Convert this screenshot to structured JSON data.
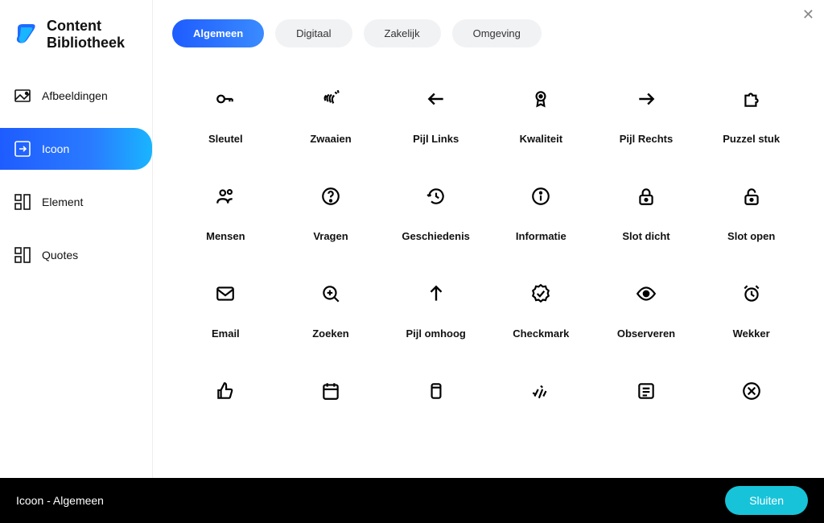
{
  "brand": {
    "title": "Content\nBibliotheek"
  },
  "sidebar": {
    "items": [
      {
        "label": "Afbeeldingen",
        "active": false
      },
      {
        "label": "Icoon",
        "active": true
      },
      {
        "label": "Element",
        "active": false
      },
      {
        "label": "Quotes",
        "active": false
      }
    ]
  },
  "tabs": [
    {
      "label": "Algemeen",
      "active": true
    },
    {
      "label": "Digitaal",
      "active": false
    },
    {
      "label": "Zakelijk",
      "active": false
    },
    {
      "label": "Omgeving",
      "active": false
    }
  ],
  "icons": [
    {
      "name": "key-icon",
      "label": "Sleutel"
    },
    {
      "name": "wave-icon",
      "label": "Zwaaien"
    },
    {
      "name": "arrow-left-icon",
      "label": "Pijl Links"
    },
    {
      "name": "quality-icon",
      "label": "Kwaliteit"
    },
    {
      "name": "arrow-right-icon",
      "label": "Pijl Rechts"
    },
    {
      "name": "puzzle-icon",
      "label": "Puzzel stuk"
    },
    {
      "name": "people-icon",
      "label": "Mensen"
    },
    {
      "name": "question-icon",
      "label": "Vragen"
    },
    {
      "name": "history-icon",
      "label": "Geschiedenis"
    },
    {
      "name": "info-icon",
      "label": "Informatie"
    },
    {
      "name": "lock-closed-icon",
      "label": "Slot dicht"
    },
    {
      "name": "lock-open-icon",
      "label": "Slot open"
    },
    {
      "name": "email-icon",
      "label": "Email"
    },
    {
      "name": "search-icon",
      "label": "Zoeken"
    },
    {
      "name": "arrow-up-icon",
      "label": "Pijl omhoog"
    },
    {
      "name": "checkmark-icon",
      "label": "Checkmark"
    },
    {
      "name": "eye-icon",
      "label": "Observeren"
    },
    {
      "name": "alarm-icon",
      "label": "Wekker"
    },
    {
      "name": "thumb-up-icon",
      "label": ""
    },
    {
      "name": "calendar-icon",
      "label": ""
    },
    {
      "name": "cup-icon",
      "label": ""
    },
    {
      "name": "sparks-icon",
      "label": ""
    },
    {
      "name": "list-icon",
      "label": ""
    },
    {
      "name": "cancel-icon",
      "label": ""
    }
  ],
  "footer": {
    "status": "Icoon - Algemeen",
    "close_label": "Sluiten"
  }
}
